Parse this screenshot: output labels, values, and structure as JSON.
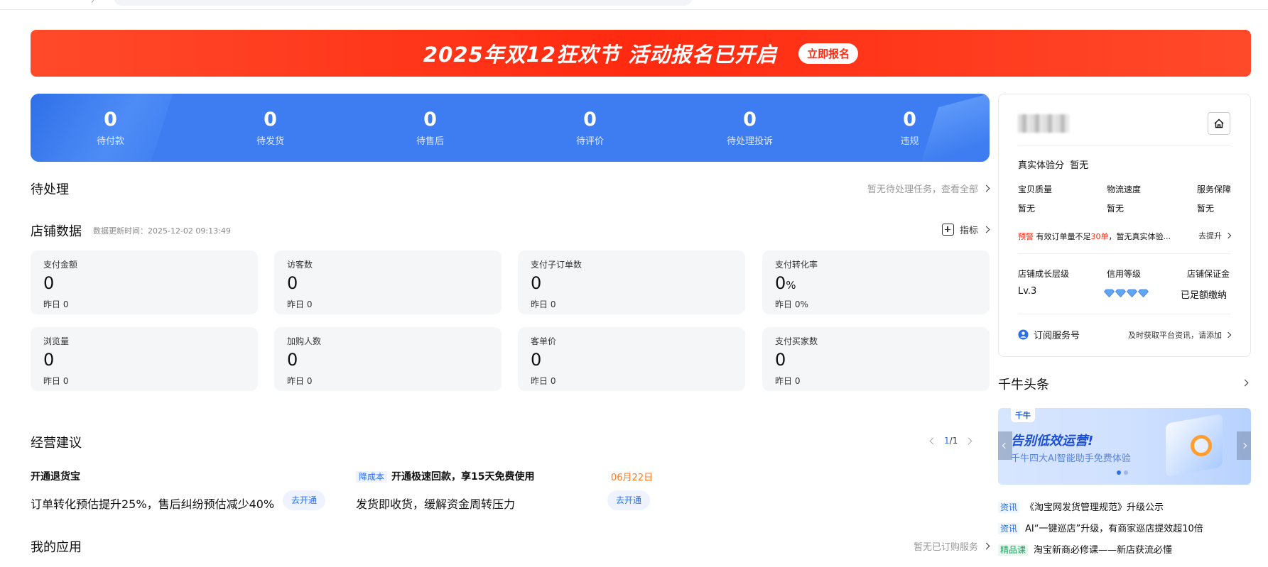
{
  "banner": {
    "title": "2025年双12狂欢节 活动报名已开启",
    "button": "立即报名"
  },
  "stats": [
    {
      "value": "0",
      "label": "待付款"
    },
    {
      "value": "0",
      "label": "待发货"
    },
    {
      "value": "0",
      "label": "待售后"
    },
    {
      "value": "0",
      "label": "待评价"
    },
    {
      "value": "0",
      "label": "待处理投诉"
    },
    {
      "value": "0",
      "label": "违规"
    }
  ],
  "todo": {
    "title": "待处理",
    "link": "暂无待处理任务，查看全部"
  },
  "shop_data": {
    "title": "店铺数据",
    "update_time": "数据更新时间：2025-12-02 09:13:49",
    "indicator_link": "指标",
    "metrics": [
      {
        "label": "支付金额",
        "value": "0",
        "unit": "",
        "yesterday": "昨日 0"
      },
      {
        "label": "访客数",
        "value": "0",
        "unit": "",
        "yesterday": "昨日 0"
      },
      {
        "label": "支付子订单数",
        "value": "0",
        "unit": "",
        "yesterday": "昨日 0"
      },
      {
        "label": "支付转化率",
        "value": "0",
        "unit": "%",
        "yesterday": "昨日 0%"
      },
      {
        "label": "浏览量",
        "value": "0",
        "unit": "",
        "yesterday": "昨日 0"
      },
      {
        "label": "加购人数",
        "value": "0",
        "unit": "",
        "yesterday": "昨日 0"
      },
      {
        "label": "客单价",
        "value": "0",
        "unit": "",
        "yesterday": "昨日 0"
      },
      {
        "label": "支付买家数",
        "value": "0",
        "unit": "",
        "yesterday": "昨日 0"
      }
    ]
  },
  "advice": {
    "title": "经营建议",
    "pager": {
      "current": "1",
      "sep": "/",
      "total": "1"
    },
    "items": [
      {
        "tag": "",
        "title": "开通退货宝",
        "desc": "订单转化预估提升25%，售后纠纷预估减少40%",
        "button": "去开通",
        "date": ""
      },
      {
        "tag": "降成本",
        "title": "开通极速回款，享15天免费使用",
        "desc": "发货即收货，缓解资金周转压力",
        "button": "去开通",
        "date": "06月22日"
      }
    ]
  },
  "apps": {
    "title": "我的应用",
    "link": "暂无已订购服务"
  },
  "shop_card": {
    "experience_label": "真实体验分",
    "experience_value": "暂无",
    "dims": [
      {
        "label": "宝贝质量",
        "value": "暂无"
      },
      {
        "label": "物流速度",
        "value": "暂无"
      },
      {
        "label": "服务保障",
        "value": "暂无"
      }
    ],
    "warning": {
      "tag": "预警",
      "text_before": "有效订单量不足",
      "highlight": "30单",
      "text_after": "，暂无真实体验...",
      "link": "去提升"
    },
    "levels": [
      {
        "label": "店铺成长层级",
        "value": "Lv.3"
      },
      {
        "label": "信用等级",
        "value": ""
      },
      {
        "label": "店铺保证金",
        "value": "已足额缴纳"
      }
    ],
    "subscribe": {
      "label": "订阅服务号",
      "desc": "及时获取平台资讯，请添加"
    }
  },
  "news": {
    "title": "千牛头条",
    "banner": {
      "logo": "千牛",
      "headline": "告别低效运营!",
      "sub": "千牛四大AI智能助手免费体验"
    },
    "items": [
      {
        "tag": "资讯",
        "text": "《淘宝网发货管理规范》升级公示"
      },
      {
        "tag": "资讯",
        "text": "AI“一键巡店”升级，有商家巡店提效超10倍"
      },
      {
        "tag": "精品课",
        "text": "淘宝新商必修课——新店获流必懂"
      }
    ]
  },
  "colors": {
    "primary": "#3e7df1",
    "banner_red": "#ff2a10",
    "success": "#17b26a"
  }
}
